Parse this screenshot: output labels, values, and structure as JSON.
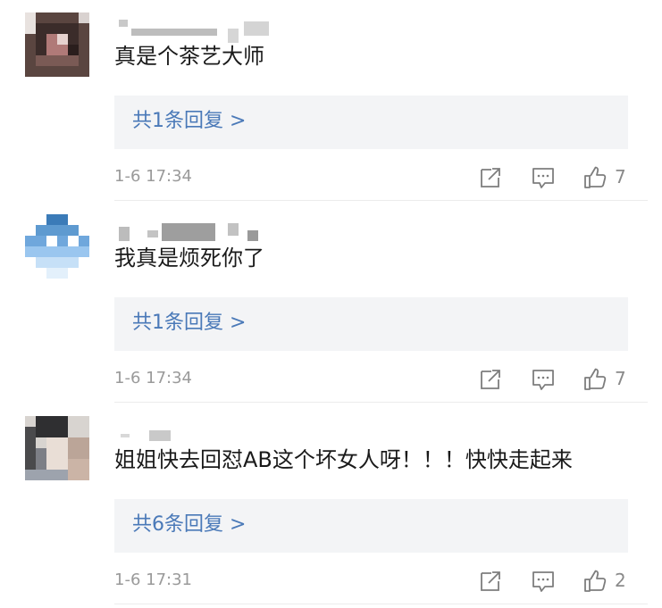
{
  "comments": [
    {
      "text": "真是个茶艺大师",
      "reply_link": "共1条回复 >",
      "time": "1-6 17:34",
      "likes": "7"
    },
    {
      "text": "我真是烦死你了",
      "reply_link": "共1条回复 >",
      "time": "1-6 17:34",
      "likes": "7"
    },
    {
      "text": "姐姐快去回怼AB这个坏女人呀！！！快快走起来",
      "reply_link": "共6条回复 >",
      "time": "1-6 17:31",
      "likes": "2"
    }
  ],
  "icons": {
    "share": "share-icon",
    "reply": "comment-icon",
    "like": "thumbs-up-icon"
  },
  "colors": {
    "link": "#4a79b8",
    "meta": "#9a9a9a",
    "reply_bg": "#f3f4f6"
  }
}
